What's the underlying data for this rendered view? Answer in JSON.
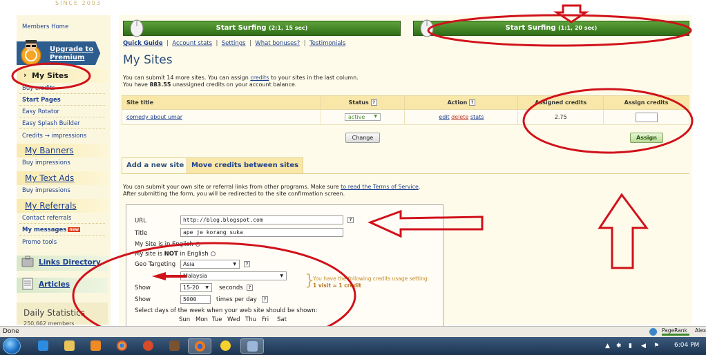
{
  "brand": "SINCE 2003",
  "sidebar": {
    "members_home": "Members Home",
    "upgrade": "Upgrade to Premium",
    "my_sites": "My Sites",
    "buy_credits": "Buy credits",
    "start_pages": "Start Pages",
    "easy_rotator": "Easy Rotator",
    "easy_splash": "Easy Splash Builder",
    "credits_impressions": "Credits → impressions",
    "my_banners": "My Banners",
    "buy_impressions_1": "Buy impressions",
    "my_text_ads": "My Text Ads",
    "buy_impressions_2": "Buy impressions",
    "my_referrals": "My Referrals",
    "contact_referrals": "Contact referrals",
    "my_messages": "My messages",
    "new_badge": "new",
    "promo_tools": "Promo tools",
    "links_directory": "Links Directory",
    "articles": "Articles",
    "daily_stats": "Daily Statistics",
    "daily_sub": "250,662 members"
  },
  "surf": {
    "btn1_label": "Start Surfing",
    "btn1_ratio": "(2:1, 15 sec)",
    "btn2_label": "Start Surfing",
    "btn2_ratio": "(1:1, 20 sec)"
  },
  "quicklinks": [
    "Quick Guide",
    "Account stats",
    "Settings",
    "What bonuses?",
    "Testimonials"
  ],
  "page_title": "My Sites",
  "info": {
    "line1_pre": "You can submit 14 more sites. You can assign ",
    "line1_link": "credits",
    "line1_post": " to your sites in the last column.",
    "line2_pre": "You have ",
    "line2_credits": "883.55",
    "line2_post": " unassigned credits on your account balance."
  },
  "table": {
    "headers": [
      "Site title",
      "Status",
      "Action",
      "Assigned credits",
      "Assign credits"
    ],
    "row": {
      "title": "comedy about umar",
      "status": "active",
      "actions": [
        "edit",
        "delete",
        "stats"
      ],
      "assigned": "2.75"
    },
    "change_btn": "Change",
    "assign_btn": "Assign"
  },
  "tabs": {
    "add": "Add a new site",
    "move": "Move credits between sites"
  },
  "submit_text": {
    "line1_pre": "You can submit your own site or referral links from other programs. Make sure ",
    "line1_link": "to read the Terms of Service",
    "line1_post": ".",
    "line2": "After submitting the form, you will be redirected to the site confirmation screen."
  },
  "form": {
    "url_label": "URL",
    "url_value": "http://blog.blogspot.com",
    "title_label": "Title",
    "title_value": "ape je korang suka",
    "english_label": "My Site is in English",
    "not_english_pre": "My site is ",
    "not_english_bold": "NOT",
    "not_english_post": " in English",
    "geo_label": "Geo Targeting",
    "geo_region": "Asia",
    "geo_country": "Malaysia",
    "show_label": "Show",
    "show_value": "15-20",
    "seconds_label": "seconds",
    "show2_label": "Show",
    "times_value": "5000",
    "times_label": "times per day",
    "days_label": "Select days of the week when your web site should be shown:",
    "days": [
      "Sun",
      "Mon",
      "Tue",
      "Wed",
      "Thu",
      "Fri",
      "Sat"
    ],
    "note_line1": "You have the following credits usage setting:",
    "note_line2": "1 visit = 1 credit"
  },
  "status_bar": {
    "text": "Done",
    "pagerank": "PageRank",
    "alexa": "Alex"
  },
  "taskbar": {
    "clock": "6:04 PM"
  },
  "colors": {
    "annotation_red": "#d0121b",
    "surf_green": "#3c8a22",
    "link_blue": "#1d3f8f"
  }
}
